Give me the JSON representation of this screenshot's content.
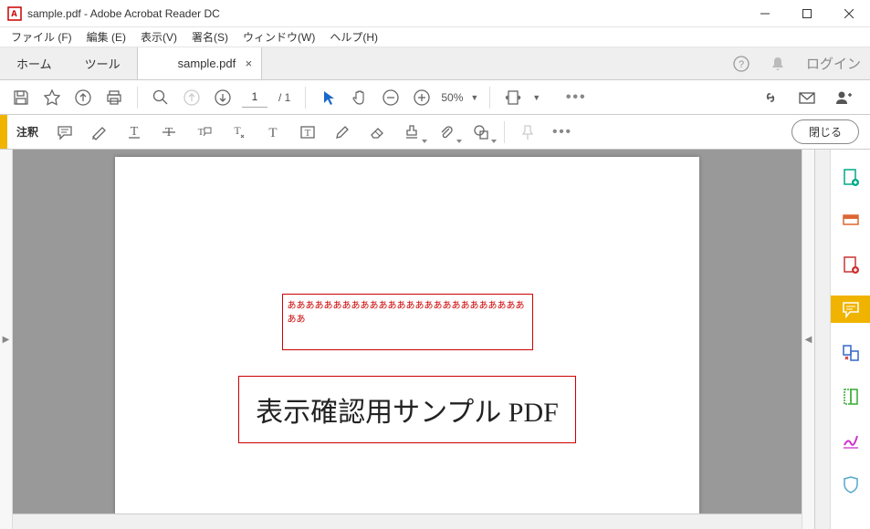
{
  "window": {
    "title": "sample.pdf - Adobe Acrobat Reader DC"
  },
  "menubar": {
    "file": "ファイル (F)",
    "edit": "編集 (E)",
    "view": "表示(V)",
    "sign": "署名(S)",
    "window": "ウィンドウ(W)",
    "help": "ヘルプ(H)"
  },
  "tabs": {
    "home": "ホーム",
    "tools": "ツール",
    "doc": "sample.pdf",
    "login": "ログイン"
  },
  "toolbar": {
    "page_current": "1",
    "page_total": "/ 1",
    "zoom": "50%"
  },
  "annobar": {
    "label": "注釈",
    "close": "閉じる"
  },
  "document": {
    "textbox1": "ああああああああああああああああああああああああああああ",
    "textbox2": "表示確認用サンプル PDF"
  }
}
